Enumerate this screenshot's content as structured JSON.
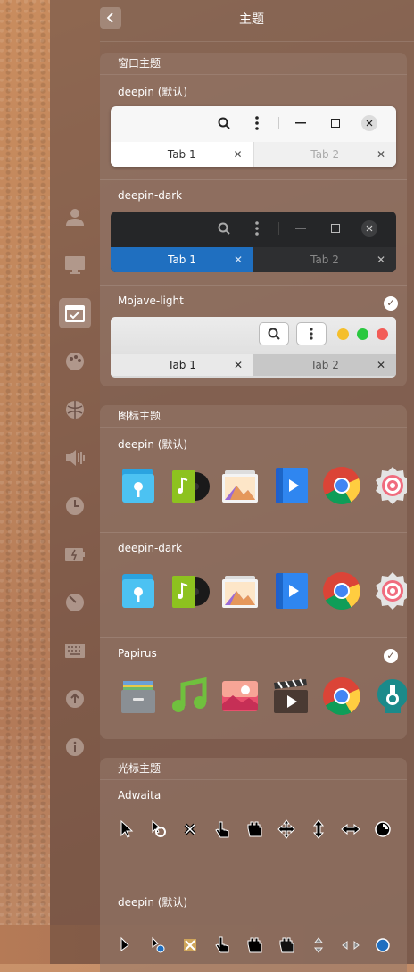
{
  "page_title": "主题",
  "sidebar": {
    "items": [
      {
        "name": "account-icon",
        "glyph": "👤",
        "active": false
      },
      {
        "name": "display-icon",
        "glyph": "🖥",
        "active": false
      },
      {
        "name": "personalization-icon",
        "glyph": "✓",
        "active": true
      },
      {
        "name": "palette-icon",
        "glyph": "🎨",
        "active": false
      },
      {
        "name": "network-icon",
        "glyph": "◉",
        "active": false
      },
      {
        "name": "sound-icon",
        "glyph": "🔈",
        "active": false
      },
      {
        "name": "time-icon",
        "glyph": "◷",
        "active": false
      },
      {
        "name": "power-icon",
        "glyph": "▭",
        "active": false
      },
      {
        "name": "mouse-icon",
        "glyph": "◐",
        "active": false
      },
      {
        "name": "keyboard-icon",
        "glyph": "⌨",
        "active": false
      },
      {
        "name": "update-icon",
        "glyph": "⬆",
        "active": false
      },
      {
        "name": "info-icon",
        "glyph": "ⓘ",
        "active": false
      }
    ]
  },
  "window_theme": {
    "header": "窗口主题",
    "items": [
      {
        "label": "deepin (默认)",
        "style": "light",
        "selected": false,
        "tab1": "Tab 1",
        "tab2": "Tab 2"
      },
      {
        "label": "deepin-dark",
        "style": "dark",
        "selected": false,
        "tab1": "Tab 1",
        "tab2": "Tab 2"
      },
      {
        "label": "Mojave-light",
        "style": "mojave",
        "selected": true,
        "tab1": "Tab 1",
        "tab2": "Tab 2"
      }
    ]
  },
  "icon_theme": {
    "header": "图标主题",
    "items": [
      {
        "label": "deepin (默认)",
        "selected": false
      },
      {
        "label": "deepin-dark",
        "selected": false
      },
      {
        "label": "Papirus",
        "selected": true
      }
    ]
  },
  "cursor_theme": {
    "header": "光标主题",
    "items": [
      {
        "label": "Adwaita",
        "selected": false
      },
      {
        "label": "deepin (默认)",
        "selected": false
      }
    ]
  },
  "check_glyph": "✓",
  "close_glyph": "✕",
  "colors": {
    "accent": "#1f6fc0",
    "traffic_yellow": "#f5bf2c",
    "traffic_green": "#2ac83f",
    "traffic_red": "#f25c57"
  }
}
